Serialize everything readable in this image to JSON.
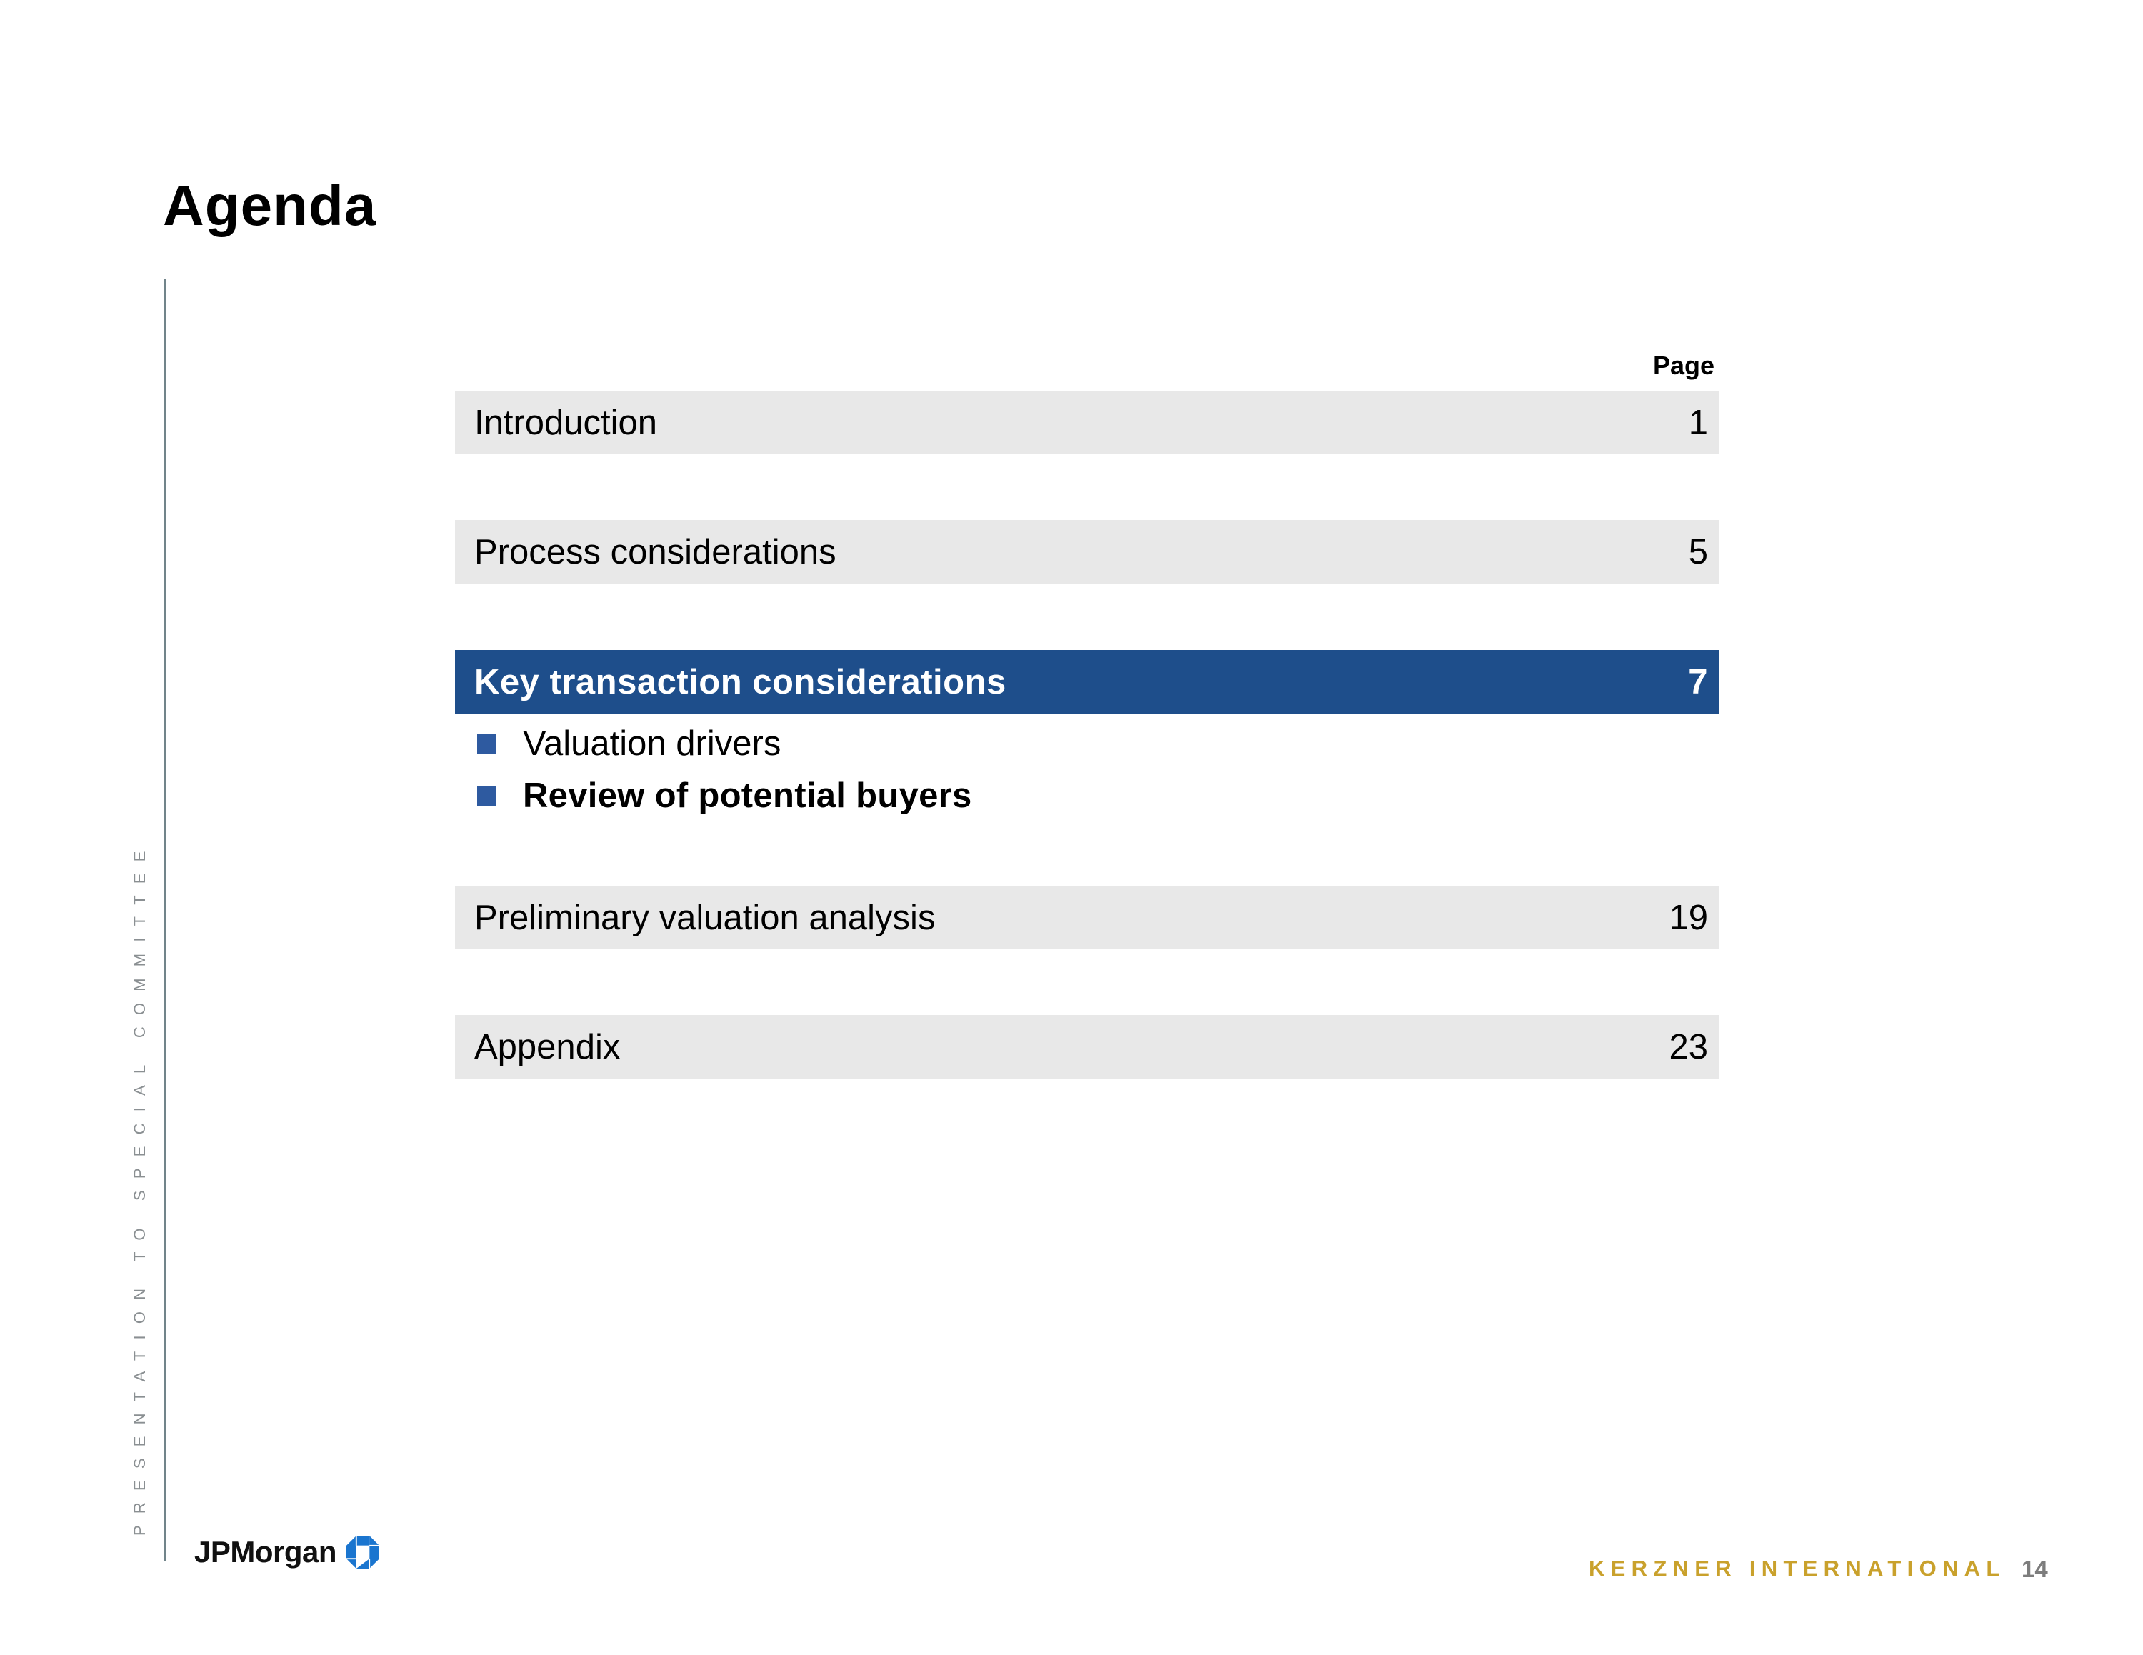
{
  "slide": {
    "title": "Agenda",
    "side_text": "PRESENTATION TO SPECIAL COMMITTEE",
    "page_column_header": "Page"
  },
  "agenda": {
    "items": [
      {
        "label": "Introduction",
        "page": "1",
        "active": false
      },
      {
        "label": "Process considerations",
        "page": "5",
        "active": false
      },
      {
        "label": "Key transaction considerations",
        "page": "7",
        "active": true,
        "subitems": [
          {
            "label": "Valuation drivers",
            "emphasis": false
          },
          {
            "label": "Review of potential buyers",
            "emphasis": true
          }
        ]
      },
      {
        "label": "Preliminary valuation analysis",
        "page": "19",
        "active": false
      },
      {
        "label": "Appendix",
        "page": "23",
        "active": false
      }
    ]
  },
  "footer": {
    "logo_text": "JPMorgan",
    "logo_icon": "chase-octagon-icon",
    "company": "KERZNER INTERNATIONAL",
    "page_number": "14"
  },
  "colors": {
    "active_row": "#1e4e8b",
    "row_background": "#e8e8e8",
    "bullet": "#2e5aa0",
    "company_gold": "#c9a12c",
    "logo_blue": "#1a75cf"
  }
}
